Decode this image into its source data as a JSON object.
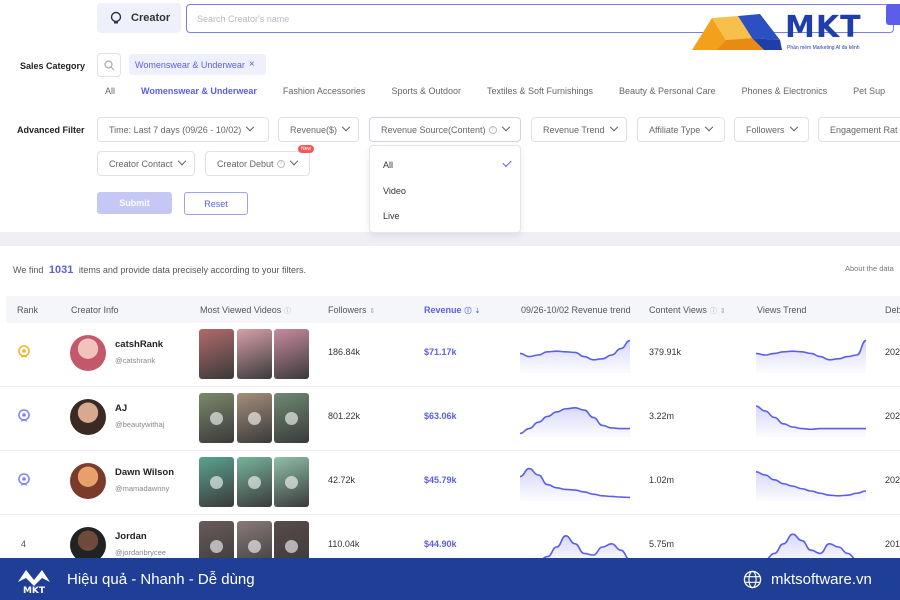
{
  "header": {
    "creator_toggle": "Creator",
    "search_placeholder": "Search Creator's name"
  },
  "logo": {
    "text": "MKT",
    "subtitle": "Phần mềm Marketing AI đa kênh"
  },
  "sales_category": {
    "label": "Sales Category",
    "selected_chip": "Womenswear & Underwear",
    "tabs": [
      "All",
      "Womenswear & Underwear",
      "Fashion Accessories",
      "Sports & Outdoor",
      "Textiles & Soft Furnishings",
      "Beauty & Personal Care",
      "Phones & Electronics",
      "Pet Sup"
    ],
    "active_tab": 1
  },
  "advanced_filter": {
    "label": "Advanced Filter",
    "row1": [
      "Time: Last 7 days (09/26 - 10/02)",
      "Revenue($)",
      "Revenue Source(Content)",
      "Revenue Trend",
      "Affiliate Type",
      "Followers",
      "Engagement Rat"
    ],
    "row2": [
      "Creator Contact",
      "Creator Debut"
    ],
    "new_badge": "New",
    "revenue_source_options": [
      "All",
      "Video",
      "Live"
    ],
    "revenue_source_selected": "All",
    "submit": "Submit",
    "reset": "Reset"
  },
  "results": {
    "prefix": "We find",
    "count": "1031",
    "suffix": "items and provide data precisely according to your filters.",
    "about": "About the data",
    "columns": [
      "Rank",
      "Creator Info",
      "Most Viewed Videos",
      "Followers",
      "Revenue",
      "09/26-10/02 Revenue trend",
      "Content Views",
      "Views Trend",
      "Deb"
    ],
    "rows": [
      {
        "rank": "1",
        "name": "catshRank",
        "handle": "@catshrank",
        "followers": "186.84k",
        "revenue": "$71.17k",
        "views": "379.91k",
        "debut": "202",
        "rev_trend": [
          0.55,
          0.45,
          0.5,
          0.6,
          0.62,
          0.6,
          0.58,
          0.45,
          0.35,
          0.38,
          0.5,
          0.7,
          0.95
        ],
        "views_trend": [
          0.55,
          0.5,
          0.55,
          0.6,
          0.62,
          0.6,
          0.55,
          0.45,
          0.35,
          0.38,
          0.45,
          0.5,
          0.95
        ]
      },
      {
        "rank": "2",
        "name": "AJ",
        "handle": "@beautywithaj",
        "followers": "801.22k",
        "revenue": "$63.06k",
        "views": "3.22m",
        "debut": "202",
        "rev_trend": [
          0.05,
          0.2,
          0.4,
          0.58,
          0.72,
          0.82,
          0.85,
          0.78,
          0.55,
          0.3,
          0.22,
          0.2,
          0.2
        ],
        "views_trend": [
          0.9,
          0.75,
          0.55,
          0.35,
          0.25,
          0.2,
          0.18,
          0.2,
          0.2,
          0.2,
          0.2,
          0.2,
          0.2
        ]
      },
      {
        "rank": "3",
        "name": "Dawn Wilson",
        "handle": "@mamadawnny",
        "followers": "42.72k",
        "revenue": "$45.79k",
        "views": "1.02m",
        "debut": "202",
        "rev_trend": [
          0.7,
          0.95,
          0.75,
          0.45,
          0.35,
          0.3,
          0.28,
          0.22,
          0.15,
          0.1,
          0.08,
          0.06,
          0.05
        ],
        "views_trend": [
          0.85,
          0.75,
          0.6,
          0.48,
          0.4,
          0.32,
          0.25,
          0.18,
          0.12,
          0.1,
          0.12,
          0.18,
          0.25
        ]
      },
      {
        "rank": "4",
        "name": "Jordan",
        "handle": "@jordanbrycee",
        "followers": "110.04k",
        "revenue": "$44.90k",
        "views": "5.75m",
        "debut": "201",
        "rev_trend": [
          0.0,
          0.0,
          0.05,
          0.2,
          0.5,
          0.85,
          0.6,
          0.3,
          0.25,
          0.5,
          0.6,
          0.4,
          0.1
        ],
        "views_trend": [
          0.0,
          0.1,
          0.3,
          0.6,
          0.9,
          0.7,
          0.4,
          0.3,
          0.6,
          0.5,
          0.3,
          0.1,
          0.0
        ]
      }
    ]
  },
  "banner": {
    "tagline": "Hiệu quả - Nhanh - Dễ dùng",
    "website": "mktsoftware.vn"
  },
  "colors": {
    "accent": "#5b5fe6",
    "banner": "#1f3f96",
    "logo_orange": "#f3a01b",
    "logo_blue": "#1f3fa8"
  }
}
